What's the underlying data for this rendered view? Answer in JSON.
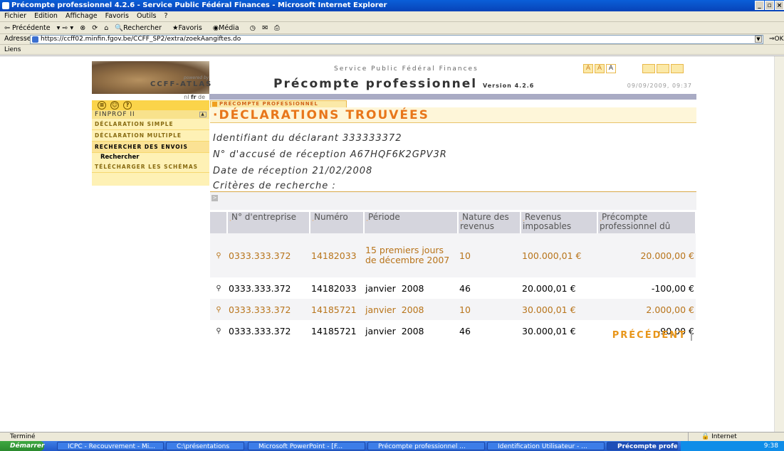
{
  "window": {
    "title": "Précompte professionnel 4.2.6 - Service Public Fédéral Finances - Microsoft Internet Explorer"
  },
  "menu": [
    "Fichier",
    "Edition",
    "Affichage",
    "Favoris",
    "Outils",
    "?"
  ],
  "toolbar": [
    "Précédente",
    "Rechercher",
    "Favoris",
    "Média"
  ],
  "address": {
    "label": "Adresse",
    "url": "https://ccff02.minfin.fgov.be/CCFF_SP2/extra/zoekAangiftes.do",
    "go": "OK"
  },
  "links": {
    "label": "Liens"
  },
  "header": {
    "powered": "powered by",
    "brand": "CCFF-ATLAS",
    "service": "Service Public Fédéral Finances",
    "title": "Précompte professionnel",
    "version": "Version 4.2.6",
    "date": "09/09/2009, 09:37",
    "font_sizes": [
      "A",
      "A",
      "A"
    ],
    "languages": {
      "nl": "nl",
      "fr": "fr",
      "de": "de"
    }
  },
  "sidebar": {
    "section": "FINPROF II",
    "items": [
      {
        "label": "DÉCLARATION SIMPLE"
      },
      {
        "label": "DÉCLARATION MULTIPLE"
      },
      {
        "label": "RECHERCHER DES ENVOIS"
      },
      {
        "label": "TÉLÉCHARGER LES SCHÉMAS"
      }
    ],
    "sub_item": "Rechercher"
  },
  "content": {
    "crumb": "PRÉCOMPTE PROFESSIONNEL",
    "title": "·DÉCLARATIONS TROUVÉES",
    "declarant": "Identifiant du déclarant 333333372",
    "accuse": "N° d'accusé de réception A67HQF6K2GPV3R",
    "reception": "Date de réception 21/02/2008",
    "criteres": "Critères de recherche :",
    "previous_button": "PRÉCÉDENT"
  },
  "table": {
    "headers": [
      "N° d'entreprise",
      "Numéro",
      "Période",
      "Nature des revenus",
      "Revenus imposables",
      "Précompte professionnel dû"
    ],
    "rows": [
      {
        "entreprise": "0333.333.372",
        "numero": "14182033",
        "periode": "15 premiers jours de décembre 2007",
        "nature": "10",
        "revenus": "100.000,01 €",
        "precompte": "20.000,00 €"
      },
      {
        "entreprise": "0333.333.372",
        "numero": "14182033",
        "periode": "janvier  2008",
        "nature": "46",
        "revenus": "20.000,01 €",
        "precompte": "-100,00 €"
      },
      {
        "entreprise": "0333.333.372",
        "numero": "14185721",
        "periode": "janvier  2008",
        "nature": "10",
        "revenus": "30.000,01 €",
        "precompte": "2.000,00 €"
      },
      {
        "entreprise": "0333.333.372",
        "numero": "14185721",
        "periode": "janvier  2008",
        "nature": "46",
        "revenus": "30.000,01 €",
        "precompte": "-90,00 €"
      }
    ]
  },
  "status": {
    "text": "Terminé",
    "zone": "Internet"
  },
  "taskbar": {
    "start": "Démarrer",
    "tasks": [
      "ICPC - Recouvrement - Mi...",
      "C:\\présentations",
      "Microsoft PowerPoint - [F...",
      "Précompte professionnel ...",
      "Identification Utilisateur - ...",
      "Précompte profession..."
    ],
    "clock": "9:38"
  }
}
